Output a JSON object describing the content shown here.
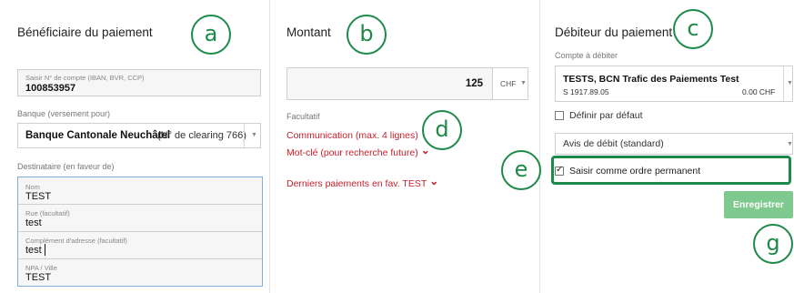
{
  "callouts": {
    "a": "a",
    "b": "b",
    "c": "c",
    "d": "d",
    "e": "e",
    "g": "g"
  },
  "beneficiary": {
    "title": "Bénéficiaire du paiement",
    "account_small": "Saisir N° de compte (IBAN, BVR, CCP)",
    "account_value": "100853957",
    "bank_label": "Banque (versement pour)",
    "bank_name": "Banque Cantonale Neuchâtel",
    "bank_clearing": "(N° de clearing 766)",
    "recipient_label": "Destinataire (en faveur de)",
    "fields": [
      {
        "label": "Nom",
        "value": "TEST"
      },
      {
        "label": "Rue (facultatif)",
        "value": "test"
      },
      {
        "label": "Complément d'adresse (facultatif)",
        "value": "test"
      },
      {
        "label": "NPA / Ville",
        "value": "TEST"
      }
    ]
  },
  "amount": {
    "title": "Montant",
    "value": "125",
    "currency": "CHF",
    "optional_label": "Facultatif",
    "communication_link": "Communication (max. 4 lignes)",
    "keyword_link": "Mot-clé (pour recherche future)",
    "last_payments_link": "Derniers paiements en fav. TEST"
  },
  "debtor": {
    "title": "Débiteur du paiement",
    "account_label": "Compte à débiter",
    "account_name": "TESTS, BCN Trafic des Paiements Test",
    "account_number": "S 1917.89.05",
    "account_balance": "0.00 CHF",
    "default_checkbox_label": "Définir par défaut",
    "default_checked": false,
    "advice_select": "Avis de débit (standard)",
    "standing_order_label": "Saisir comme ordre permanent",
    "standing_order_checked": true,
    "save_button": "Enregistrer"
  },
  "colors": {
    "callout": "#1e8a4a",
    "link_red": "#c8202e",
    "save_button_bg": "#7ec98d",
    "focus_border": "#7fb0dc"
  },
  "icons": {
    "chevron": "chevron-down-icon",
    "select_arrow": "caret-down-icon",
    "check": "checkmark-icon"
  }
}
